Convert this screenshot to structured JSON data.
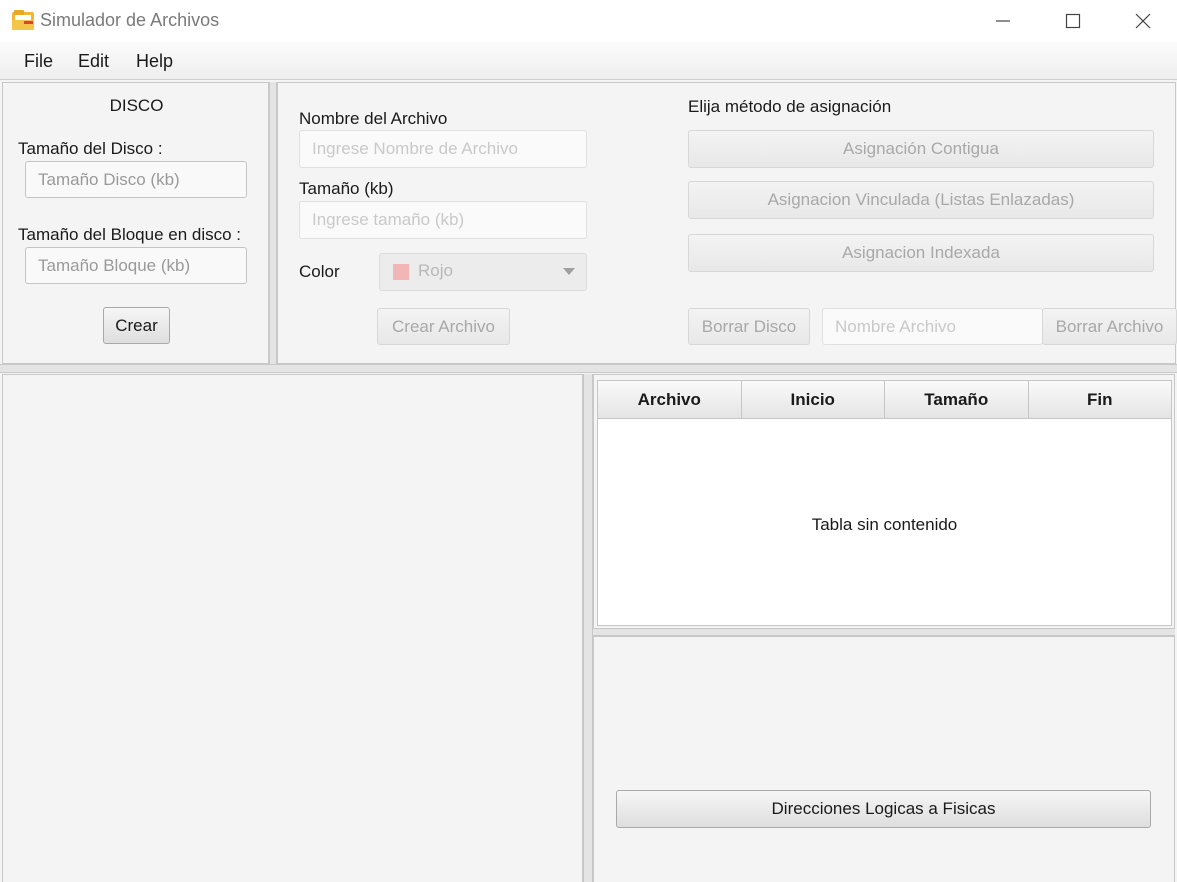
{
  "window": {
    "title": "Simulador de Archivos",
    "icon": "folder-icon",
    "controls": [
      "minimize-icon",
      "maximize-icon",
      "close-icon"
    ]
  },
  "menu": {
    "file": "File",
    "edit": "Edit",
    "help": "Help"
  },
  "disk_panel": {
    "title": "DISCO",
    "disk_size_label": "Tamaño del Disco :",
    "disk_size_placeholder": "Tamaño Disco (kb)",
    "block_size_label": "Tamaño del Bloque en disco :",
    "block_size_placeholder": "Tamaño Bloque (kb)",
    "create_button": "Crear"
  },
  "file_panel": {
    "name_label": "Nombre del Archivo",
    "name_placeholder": "Ingrese Nombre de Archivo",
    "size_label": "Tamaño (kb)",
    "size_placeholder": "Ingrese tamaño (kb)",
    "color_label": "Color",
    "color_value": "Rojo",
    "color_swatch": "#f3b6b6",
    "create_file_button": "Crear Archivo"
  },
  "allocation_panel": {
    "title": "Elija método de asignación",
    "contiguous_button": "Asignación Contigua",
    "linked_button": "Asignacion Vinculada (Listas Enlazadas)",
    "indexed_button": "Asignacion Indexada",
    "delete_disk_button": "Borrar Disco",
    "delete_name_placeholder": "Nombre Archivo",
    "delete_file_button": "Borrar Archivo"
  },
  "files_table": {
    "columns": [
      "Archivo",
      "Inicio",
      "Tamaño",
      "Fin"
    ],
    "empty_message": "Tabla sin contenido"
  },
  "logical_panel": {
    "button": "Direcciones Logicas a Fisicas"
  }
}
